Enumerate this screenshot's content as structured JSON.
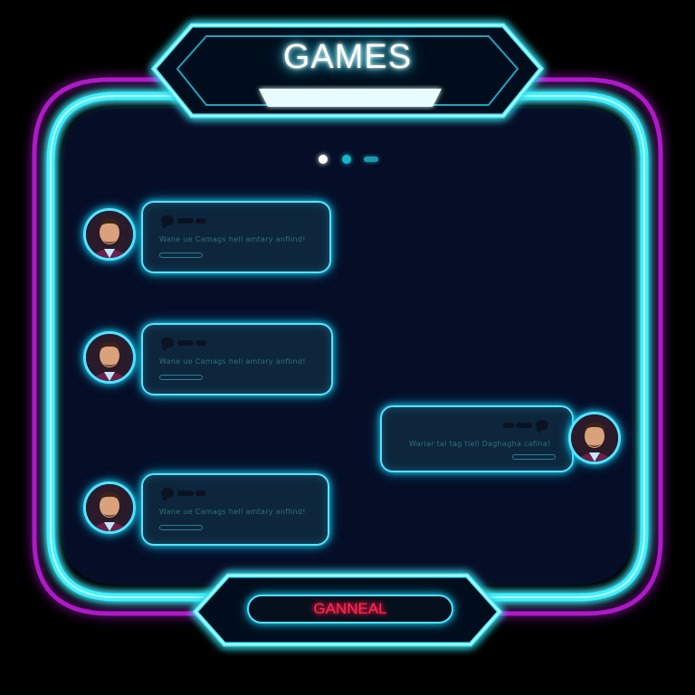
{
  "header": {
    "title": "GAMES"
  },
  "pager": {
    "count": 3,
    "active_index": 0
  },
  "messages": [
    {
      "side": "left",
      "text": "Wane ue Camags hell amtary anflind!",
      "avatar_icon": "user-avatar-icon"
    },
    {
      "side": "left",
      "text": "Wane ue Camags hell amtary anflind!",
      "avatar_icon": "user-avatar-icon"
    },
    {
      "side": "right",
      "text": "Warlar tal tag tlell Daghagha cafina!",
      "avatar_icon": "user-avatar-icon"
    },
    {
      "side": "left",
      "text": "Wane ue Camags hell amtary anflind!",
      "avatar_icon": "user-avatar-icon"
    }
  ],
  "footer": {
    "button_label": "GANNEAL"
  },
  "colors": {
    "background": "#000000",
    "panel": "#060d26",
    "neon_cyan": "#3ff0ff",
    "neon_magenta": "#c21fe0",
    "button_text": "#ff2a55"
  }
}
